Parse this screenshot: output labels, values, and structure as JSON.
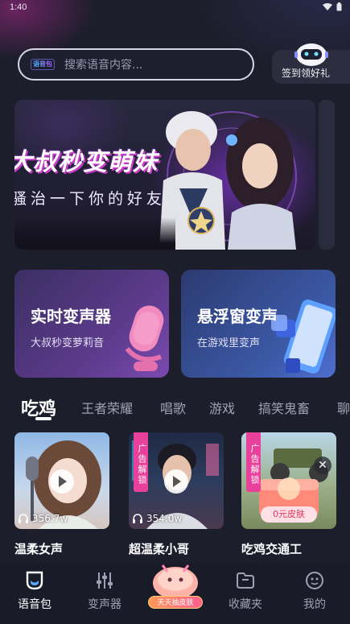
{
  "status_bar": {
    "time": "1:40"
  },
  "search": {
    "tag": "语音包",
    "placeholder": "搜索语音内容..."
  },
  "checkin": {
    "label": "签到领好礼"
  },
  "banner": {
    "title": "大叔秒变萌妹",
    "subtitle": "骚治一下你的好友"
  },
  "features": [
    {
      "title": "实时变声器",
      "subtitle": "大叔秒变萝莉音"
    },
    {
      "title": "悬浮窗变声",
      "subtitle": "在游戏里变声"
    }
  ],
  "category_tabs": {
    "active": "吃鸡",
    "items": [
      "吃鸡",
      "王者荣耀",
      "唱歌",
      "游戏",
      "搞笑鬼畜",
      "聊"
    ]
  },
  "voice_items": [
    {
      "name": "温柔女声",
      "plays": "356.7w",
      "ad_label": ""
    },
    {
      "name": "超温柔小哥",
      "plays": "354.0w",
      "ad_label": "广告解锁"
    },
    {
      "name": "吃鸡交通工",
      "plays": "",
      "ad_label": "广告解锁",
      "badge": "0元皮肤"
    }
  ],
  "bottom_nav": {
    "items": [
      {
        "label": "语音包",
        "icon": "voice-pack-icon",
        "active": true
      },
      {
        "label": "变声器",
        "icon": "sliders-icon",
        "active": false
      },
      {
        "label": "收藏夹",
        "icon": "folder-icon",
        "active": false
      },
      {
        "label": "我的",
        "icon": "profile-icon",
        "active": false
      }
    ],
    "center_tag": "天天抽皮肤"
  },
  "colors": {
    "background": "#1d1e2c",
    "ad_tag": "#e9419b",
    "text_muted": "#9fa0b5"
  }
}
